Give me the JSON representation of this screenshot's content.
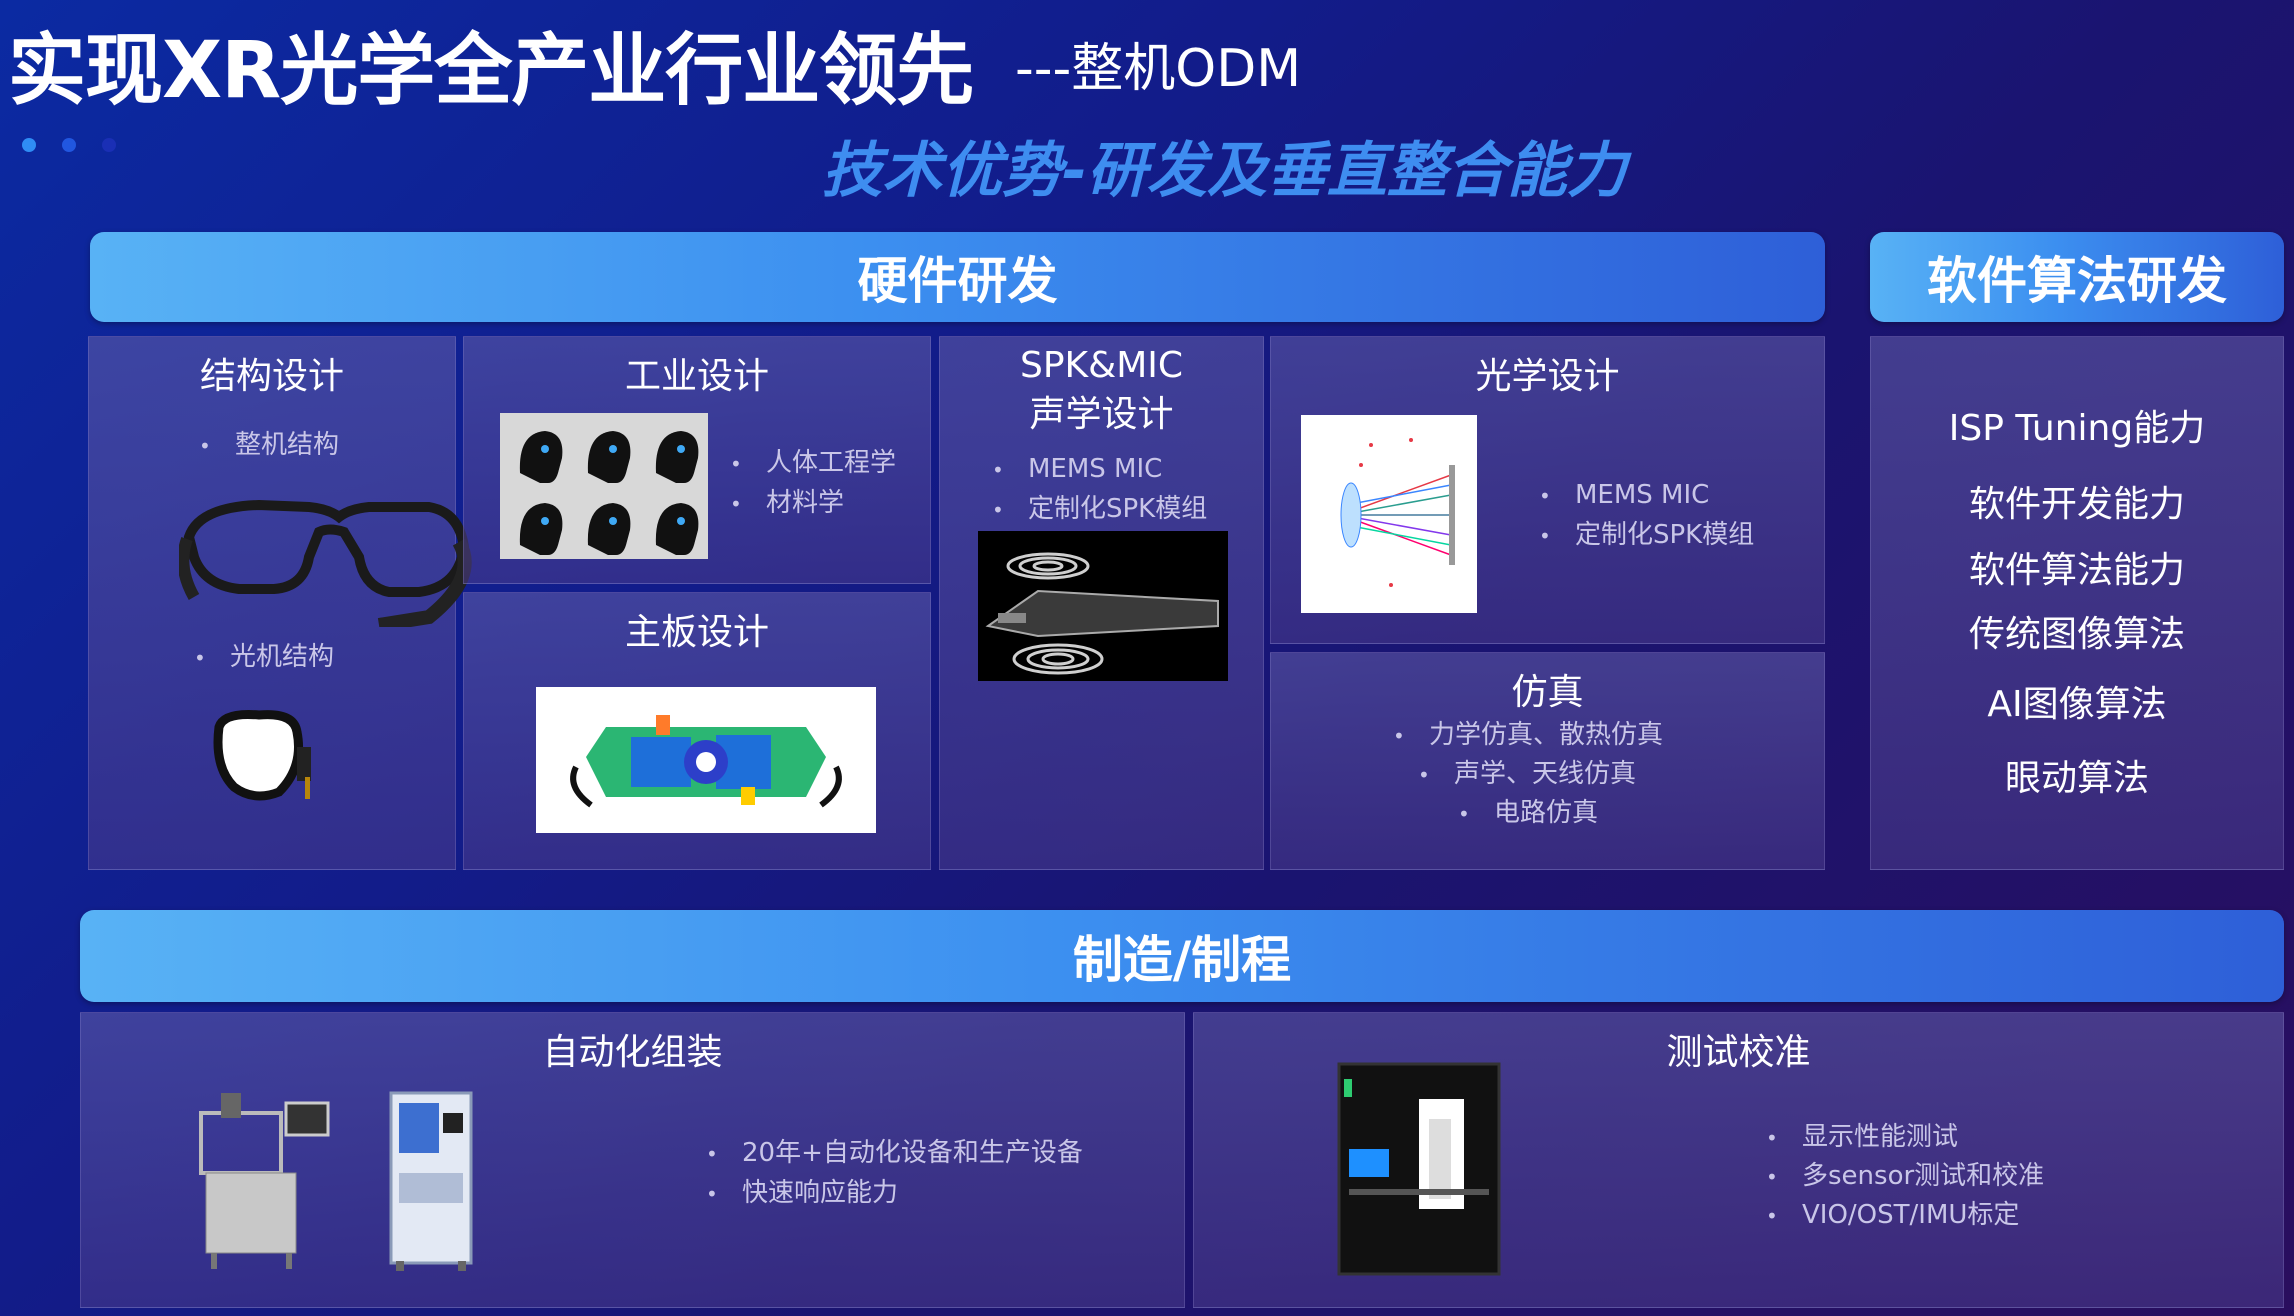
{
  "header": {
    "title": "实现XR光学全产业行业领先",
    "title_suffix": "---整机ODM",
    "subtitle": "技术优势-研发及垂直整合能力",
    "dot_colors": [
      "#2f8df5",
      "#2157e0",
      "#1a2fb5"
    ]
  },
  "hardware": {
    "banner": "硬件研发",
    "structure": {
      "title": "结构设计",
      "item1": "整机结构",
      "item2": "光机结构"
    },
    "industrial": {
      "title": "工业设计",
      "items": [
        "人体工程学",
        "材料学"
      ]
    },
    "mainboard": {
      "title": "主板设计"
    },
    "acoustic": {
      "title_line1": "SPK&MIC",
      "title_line2": "声学设计",
      "items": [
        "MEMS MIC",
        "定制化SPK模组"
      ]
    },
    "optical": {
      "title": "光学设计",
      "items": [
        "MEMS MIC",
        "定制化SPK模组"
      ]
    },
    "simulation": {
      "title": "仿真",
      "items": [
        "力学仿真、散热仿真",
        "声学、天线仿真",
        "电路仿真"
      ]
    }
  },
  "software": {
    "banner": "软件算法研发",
    "items": [
      "ISP Tuning能力",
      "软件开发能力",
      "软件算法能力",
      "传统图像算法",
      "AI图像算法",
      "眼动算法"
    ]
  },
  "manufacturing": {
    "banner": "制造/制程",
    "assembly": {
      "title": "自动化组装",
      "items": [
        "20年+自动化设备和生产设备",
        "快速响应能力"
      ]
    },
    "testing": {
      "title": "测试校准",
      "items": [
        "显示性能测试",
        "多sensor测试和校准",
        "VIO/OST/IMU标定"
      ]
    }
  }
}
